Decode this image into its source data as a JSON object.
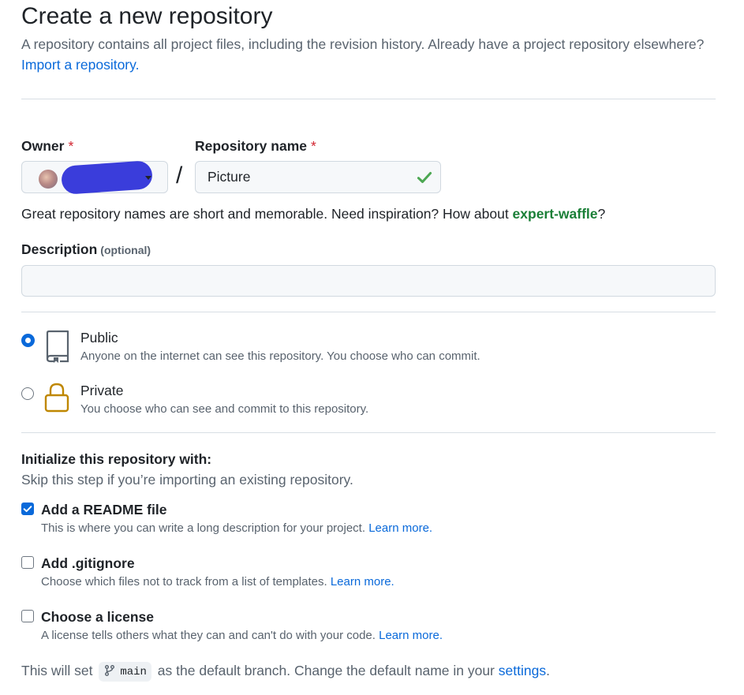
{
  "header": {
    "title": "Create a new repository",
    "subtitle": "A repository contains all project files, including the revision history. Already have a project repository elsewhere?",
    "import_link": "Import a repository."
  },
  "owner": {
    "label": "Owner",
    "required_mark": "*"
  },
  "repo_name": {
    "label": "Repository name",
    "required_mark": "*",
    "value": "Picture",
    "valid": true
  },
  "name_hint": {
    "text_before": "Great repository names are short and memorable. Need inspiration? How about ",
    "suggestion": "expert-waffle",
    "text_after": "?"
  },
  "description": {
    "label": "Description",
    "optional_label": "(optional)",
    "value": ""
  },
  "visibility": {
    "selected": "Public",
    "options": [
      {
        "title": "Public",
        "desc": "Anyone on the internet can see this repository. You choose who can commit.",
        "icon": "repo-icon"
      },
      {
        "title": "Private",
        "desc": "You choose who can see and commit to this repository.",
        "icon": "lock-icon"
      }
    ]
  },
  "initialize": {
    "title": "Initialize this repository with:",
    "subtitle": "Skip this step if you’re importing an existing repository.",
    "options": [
      {
        "title": "Add a README file",
        "desc": "This is where you can write a long description for your project.",
        "link": "Learn more.",
        "checked": true
      },
      {
        "title": "Add .gitignore",
        "desc": "Choose which files not to track from a list of templates.",
        "link": "Learn more.",
        "checked": false
      },
      {
        "title": "Choose a license",
        "desc": "A license tells others what they can and can't do with your code.",
        "link": "Learn more.",
        "checked": false
      }
    ]
  },
  "footer": {
    "text_before": "This will set",
    "branch": "main",
    "text_middle": "as the default branch. Change the default name in your",
    "settings_link": "settings",
    "text_after": "."
  },
  "colors": {
    "link": "#0969da",
    "success": "#1a7f37",
    "required": "#d1242f",
    "lock": "#bf8700"
  }
}
